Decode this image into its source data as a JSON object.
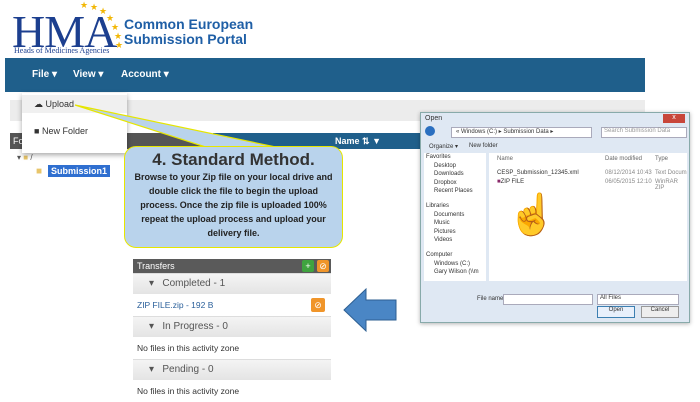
{
  "logo": {
    "text": "HMA",
    "subtitle": "Heads of Medicines Agencies"
  },
  "portal_title": {
    "line1": "Common European",
    "line2": "Submission Portal"
  },
  "nav": {
    "items": [
      "File",
      "View",
      "Account"
    ]
  },
  "file_menu": {
    "items": [
      "Upload",
      "New Folder"
    ]
  },
  "folders": {
    "header": "Fo",
    "root": "/",
    "child": "Submission1"
  },
  "grid": {
    "name_header": "Name"
  },
  "callout": {
    "title": "4. Standard Method.",
    "body": "Browse to your Zip file on your local drive and double click the file to begin the upload process. Once the zip file is uploaded 100% repeat the upload process and upload your delivery file."
  },
  "transfers": {
    "title": "Transfers",
    "completed": "Completed - 1",
    "file": "ZIP FILE.zip - 192 B",
    "in_progress": "In Progress - 0",
    "empty1": "No files in this activity zone",
    "pending": "Pending - 0",
    "empty2": "No files in this activity zone"
  },
  "dialog": {
    "title": "Open",
    "path": "« Windows (C:) ▸ Submission Data ▸",
    "search": "Search Submission Data",
    "organize": "Organize ▾",
    "new_folder": "New folder",
    "nav_items": [
      "Favorites",
      "Desktop",
      "Downloads",
      "Dropbox",
      "Recent Places",
      "Libraries",
      "Documents",
      "Music",
      "Pictures",
      "Videos",
      "Computer",
      "Windows (C:)",
      "Gary Wilson (\\\\m"
    ],
    "columns": [
      "Name",
      "Date modified",
      "Type"
    ],
    "files": [
      {
        "name": "CESP_Submission_12345.xml",
        "date": "08/12/2014 10:43",
        "type": "Text Docum"
      },
      {
        "name": "ZIP FILE",
        "date": "06/05/2015 12:10",
        "type": "WinRAR ZIP"
      }
    ],
    "file_name_label": "File name:",
    "filter": "All Files",
    "open": "Open",
    "cancel": "Cancel"
  },
  "colors": {
    "nav": "#1f5f8b",
    "callout": "#b9d3ec",
    "accent_orange": "#f0952a",
    "arrow": "#4a86c5"
  }
}
